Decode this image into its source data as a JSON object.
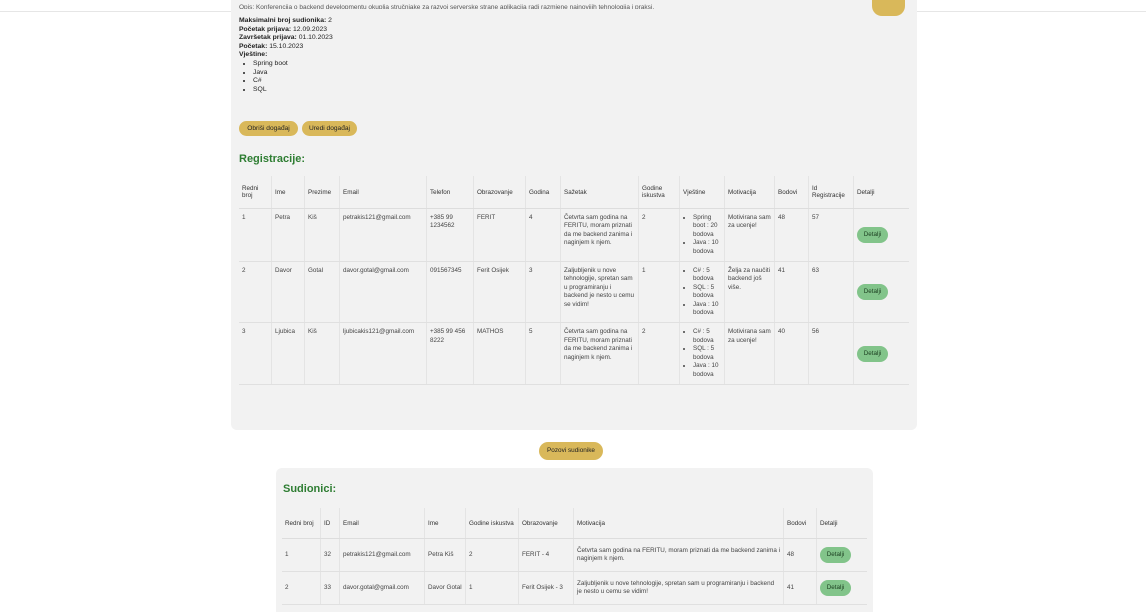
{
  "event": {
    "description_cut": "Opis: Konferencija o backend developmentu okuplja stručnjake za razvoj serverske strane aplikacija radi razmjene najnovijih tehnologija i praksi.",
    "max_label": "Maksimalni broj sudionika:",
    "max_value": " 2",
    "reg_start_label": "Početak prijava:",
    "reg_start_value": " 12.09.2023",
    "reg_end_label": "Završetak prijava:",
    "reg_end_value": " 01.10.2023",
    "start_label": "Početak:",
    "start_value": " 15.10.2023",
    "skills_label": "Vještine:",
    "skills": [
      "Spring boot",
      "Java",
      "C#",
      "SQL"
    ],
    "delete_button": "Obriši događaj",
    "edit_button": "Uredi događaj"
  },
  "registrations": {
    "title": "Registracije:",
    "headers": [
      "Redni broj",
      "Ime",
      "Prezime",
      "Email",
      "Telefon",
      "Obrazovanje",
      "Godina",
      "Sažetak",
      "Godine iskustva",
      "Vještine",
      "Motivacija",
      "Bodovi",
      "Id Registracije",
      "Detalji"
    ],
    "rows": [
      {
        "no": "1",
        "first": "Petra",
        "last": "Kiš",
        "email": "petrakis121@gmail.com",
        "phone": "+385 99 1234562",
        "edu": "FERIT",
        "year": "4",
        "summary": "Četvrta sam godina na FERITU, moram priznati da me backend zanima i naginjem k njem.",
        "exp": "2",
        "skills": [
          "Spring boot : 20 bodova",
          "Java : 10 bodova"
        ],
        "motivation": "Motivirana sam za ucenje!",
        "points": "48",
        "reg_id": "57",
        "details": "Detalji"
      },
      {
        "no": "2",
        "first": "Davor",
        "last": "Gotal",
        "email": "davor.gotal@gmail.com",
        "phone": "091567345",
        "edu": "Ferit Osijek",
        "year": "3",
        "summary": "Zaljubljenik u nove tehnologije, spretan sam u programiranju i backend je nesto u cemu se vidim!",
        "exp": "1",
        "skills": [
          "C# : 5 bodova",
          "SQL : 5 bodova",
          "Java : 10 bodova"
        ],
        "motivation": "Želja za naučiti backend još više.",
        "points": "41",
        "reg_id": "63",
        "details": "Detalji"
      },
      {
        "no": "3",
        "first": "Ljubica",
        "last": "Kiš",
        "email": "ljubicakis121@gmail.com",
        "phone": "+385 99 456 8222",
        "edu": "MATHOS",
        "year": "5",
        "summary": "Četvrta sam godina na FERITU, moram priznati da me backend zanima i naginjem k njem.",
        "exp": "2",
        "skills": [
          "C# : 5 bodova",
          "SQL : 5 bodova",
          "Java : 10 bodova"
        ],
        "motivation": "Motivirana sam za ucenje!",
        "points": "40",
        "reg_id": "56",
        "details": "Detalji"
      }
    ]
  },
  "call_button": "Pozovi sudionike",
  "participants": {
    "title": "Sudionici:",
    "headers": [
      "Redni broj",
      "ID",
      "Email",
      "Ime",
      "Godine iskustva",
      "Obrazovanje",
      "Motivacija",
      "Bodovi",
      "Detalji"
    ],
    "rows": [
      {
        "no": "1",
        "id": "32",
        "email": "petrakis121@gmail.com",
        "name": "Petra Kiš",
        "exp": "2",
        "edu": "FERIT - 4",
        "motivation": "Četvrta sam godina na FERITU, moram priznati da me backend zanima i naginjem k njem.",
        "points": "48",
        "details": "Detalji"
      },
      {
        "no": "2",
        "id": "33",
        "email": "davor.gotal@gmail.com",
        "name": "Davor Gotal",
        "exp": "1",
        "edu": "Ferit Osijek - 3",
        "motivation": "Zaljubljenik u nove tehnologije, spretan sam u programiranju i backend je nesto u cemu se vidim!",
        "points": "41",
        "details": "Detalji"
      }
    ]
  },
  "colors": {
    "accent_gold": "#d9b85a",
    "accent_green": "#82c48a",
    "heading_green": "#2e7d32"
  }
}
